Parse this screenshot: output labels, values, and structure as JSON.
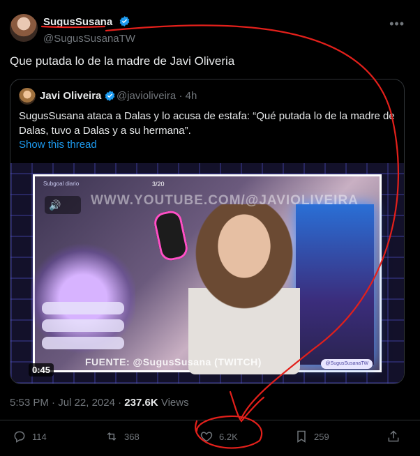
{
  "author": {
    "name": "SugusSusana",
    "handle": "@SugusSusanaTW"
  },
  "tweet": {
    "text": "Que putada lo de la madre de Javi Oliveria"
  },
  "quote": {
    "name": "Javi Oliveira",
    "handle": "@javioliveira",
    "separator": "·",
    "time": "4h",
    "text": "SugusSusana ataca a Dalas y lo acusa de estafa: “Qué putada lo de la madre de Dalas, tuvo a Dalas y a su hermana”.",
    "show_thread": "Show this thread",
    "media": {
      "duration": "0:45",
      "overlay_label": "Subgoal diario",
      "overlay_count": "3/20",
      "watermark_top": "WWW.YOUTUBE.COM/@JAVIOLIVEIRA",
      "watermark_bottom": "FUENTE: @SugusSusana (TWITCH)",
      "twitch_badge": "@SugusSusanaTW",
      "speaker_label": "🔊"
    }
  },
  "meta": {
    "time": "5:53 PM",
    "dot": "·",
    "date": "Jul 22, 2024",
    "views_count": "237.6K",
    "views_label": "Views"
  },
  "actions": {
    "reply_count": "114",
    "retweet_count": "368",
    "like_count": "6.2K",
    "bookmark_count": "259"
  },
  "icons": {
    "verified": "verified-badge-icon",
    "more": "more-icon",
    "reply": "reply-icon",
    "retweet": "retweet-icon",
    "like": "heart-icon",
    "bookmark": "bookmark-icon",
    "share": "share-icon"
  },
  "colors": {
    "background": "#000000",
    "accent": "#1d9bf0",
    "muted": "#71767b",
    "annotation": "#e3201b"
  }
}
